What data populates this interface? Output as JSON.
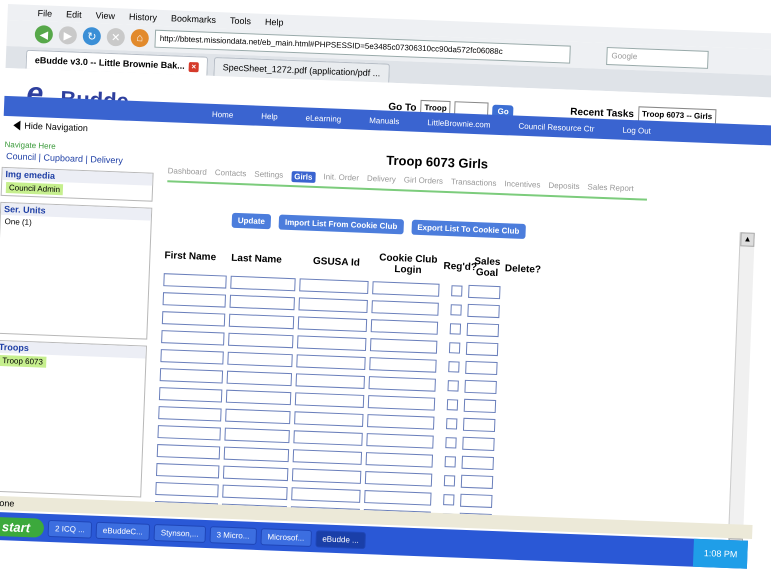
{
  "browser": {
    "menu": [
      "File",
      "Edit",
      "View",
      "History",
      "Bookmarks",
      "Tools",
      "Help"
    ],
    "url": "http://bbtest.missiondata.net/eb_main.html#PHPSESSID=5e3485c07306310cc90da572fc06088c",
    "search_placeholder": "Google",
    "tabs": [
      {
        "label": "eBudde v3.0 -- Little Brownie Bak..."
      },
      {
        "label": "SpecSheet_1272.pdf (application/pdf ..."
      }
    ]
  },
  "header": {
    "logo_letter": "e",
    "logo_word": "Budde",
    "goto_label": "Go To",
    "goto_value": "Troop",
    "go_btn": "Go",
    "recent_label": "Recent Tasks",
    "recent_value": "Troop 6073 -- Girls",
    "nav": [
      "Home",
      "Help",
      "eLearning",
      "Manuals",
      "LittleBrownie.com",
      "Council Resource Ctr",
      "Log Out"
    ]
  },
  "left": {
    "hide_nav": "Hide Navigation",
    "nav_here": "Navigate Here",
    "links": [
      "Council",
      "Cupboard",
      "Delivery"
    ],
    "org": {
      "title": "Img emedia",
      "item": "Council Admin"
    },
    "units": {
      "title": "Ser. Units",
      "item": "One (1)"
    },
    "troops": {
      "title": "Troops",
      "item": "Troop 6073"
    }
  },
  "main": {
    "title": "Troop 6073 Girls",
    "tabs": [
      "Dashboard",
      "Contacts",
      "Settings",
      "Girls",
      "Init. Order",
      "Delivery",
      "Girl Orders",
      "Transactions",
      "Incentives",
      "Deposits",
      "Sales Report"
    ],
    "active_tab": "Girls",
    "buttons": [
      "Update",
      "Import List From Cookie Club",
      "Export List To Cookie Club"
    ],
    "columns": [
      "First Name",
      "Last Name",
      "GSUSA Id",
      "Cookie Club Login",
      "Reg'd?",
      "Sales Goal",
      "Delete?"
    ],
    "row_count": 13
  },
  "status": {
    "text": "Done"
  },
  "taskbar": {
    "start": "start",
    "items": [
      "2 ICQ ...",
      "eBuddeC...",
      "Stynson,...",
      "3 Micro...",
      "Microsof...",
      "eBudde ..."
    ],
    "active": "eBudde ...",
    "clock": "1:08 PM"
  }
}
